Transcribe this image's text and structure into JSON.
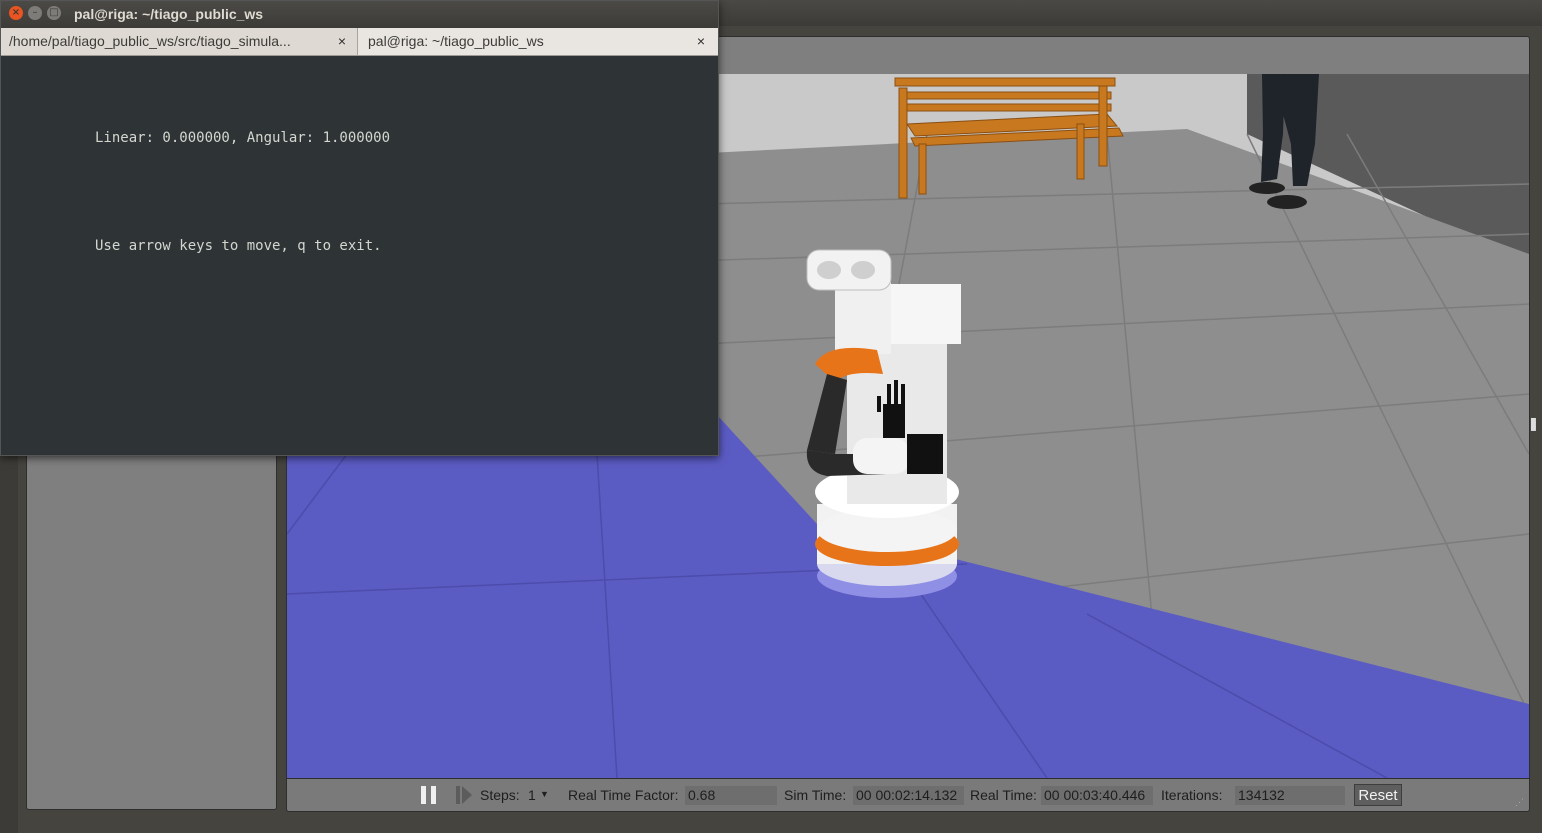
{
  "terminal": {
    "title": "pal@riga: ~/tiago_public_ws",
    "tabs": [
      {
        "label": "/home/pal/tiago_public_ws/src/tiago_simula...",
        "close": "×"
      },
      {
        "label": "pal@riga: ~/tiago_public_ws",
        "close": "×"
      }
    ],
    "lines": [
      "Linear: 0.000000, Angular: 1.000000",
      "Use arrow keys to move, q to exit."
    ],
    "window_buttons": {
      "close": "×",
      "minimize": "–",
      "maximize": "□"
    }
  },
  "gazebo": {
    "statusbar": {
      "steps_label": "Steps:",
      "steps_value": "1",
      "rtf_label": "Real Time Factor:",
      "rtf_value": "0.68",
      "sim_time_label": "Sim Time:",
      "sim_time_value": "00 00:02:14.132",
      "real_time_label": "Real Time:",
      "real_time_value": "00 00:03:40.446",
      "iterations_label": "Iterations:",
      "iterations_value": "134132",
      "reset_label": "Reset"
    },
    "icons": [
      "pause-icon",
      "step-icon",
      "dropdown-arrow-icon",
      "splitter-handle-icon",
      "resize-grip-icon"
    ],
    "colors": {
      "floor_tile": "#8c8c8c",
      "wall": "#c8c8c8",
      "laser_area": "#5b5bc4",
      "robot_orange": "#e8741a",
      "bench_wood": "#c8781e"
    }
  }
}
